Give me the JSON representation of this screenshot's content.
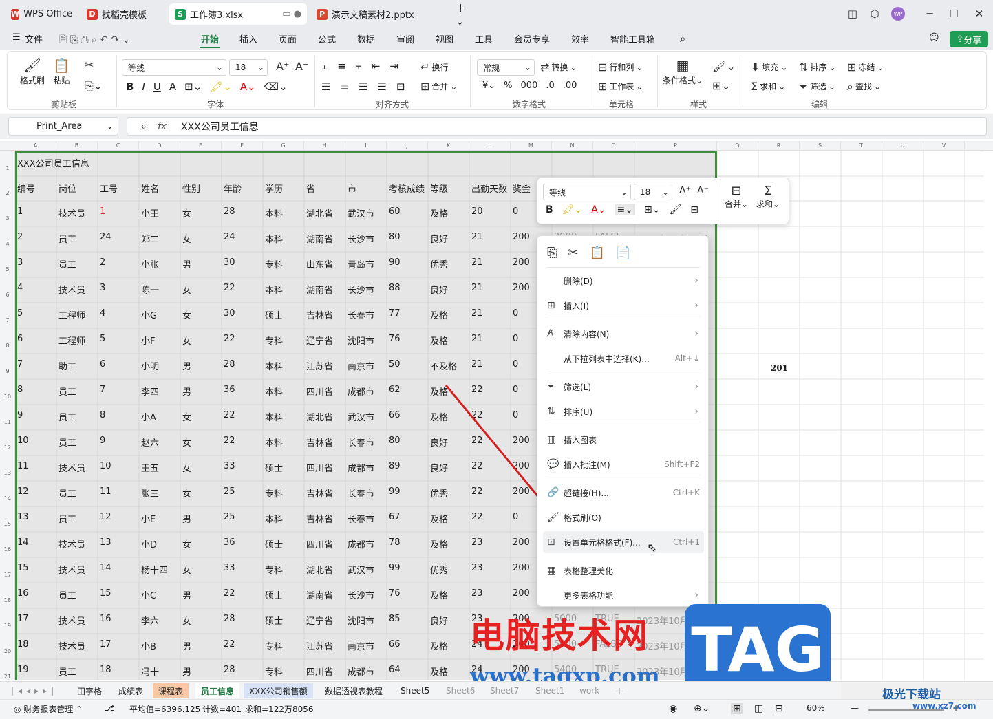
{
  "tabs": [
    {
      "label": "WPS Office",
      "icon": "wps-logo-icon",
      "color": "#d9372b",
      "glyph": "W"
    },
    {
      "label": "找稻壳模板",
      "icon": "docer-icon",
      "color": "#d9372b",
      "glyph": "D"
    },
    {
      "label": "工作簿3.xlsx",
      "icon": "spreadsheet-icon",
      "color": "#1e9b54",
      "glyph": "S"
    },
    {
      "label": "演示文稿素材2.pptx",
      "icon": "presentation-icon",
      "color": "#d84a2b",
      "glyph": "P"
    }
  ],
  "menu": [
    "文件",
    "开始",
    "插入",
    "页面",
    "公式",
    "数据",
    "审阅",
    "视图",
    "工具",
    "会员专享",
    "效率",
    "智能工具箱"
  ],
  "share": "分享",
  "ribbon": {
    "format_painter": "格式刷",
    "paste": "粘贴",
    "clipboard": "剪贴板",
    "font_name": "等线",
    "font_size": "18",
    "font": "字体",
    "wrap": "换行",
    "merge": "合并",
    "align": "对齐方式",
    "numfmt": "常规",
    "convert": "转换",
    "number": "数字格式",
    "rowcol": "行和列",
    "sheet": "工作表",
    "cells": "单元格",
    "condfmt": "条件格式",
    "styles": "样式",
    "fill": "填充",
    "sort": "排序",
    "freeze": "冻结",
    "sum": "求和",
    "filter": "筛选",
    "find": "查找",
    "edit": "编辑"
  },
  "namebox": "Print_Area",
  "formula": "XXX公司员工信息",
  "columns": [
    "A",
    "B",
    "C",
    "D",
    "E",
    "F",
    "G",
    "H",
    "I",
    "J",
    "K",
    "L",
    "M",
    "N",
    "O",
    "P",
    "Q",
    "R",
    "S",
    "T",
    "U",
    "V"
  ],
  "rows": [
    "1",
    "2",
    "3",
    "4",
    "5",
    "6",
    "7",
    "8",
    "9",
    "10",
    "11",
    "12",
    "13",
    "14",
    "15",
    "16",
    "17",
    "18",
    "19",
    "20",
    "21"
  ],
  "title": "XXX公司员工信息",
  "headers": [
    "编号",
    "岗位",
    "工号",
    "姓名",
    "性别",
    "年龄",
    "学历",
    "省",
    "市",
    "考核成绩",
    "等级",
    "出勤天数",
    "奖金"
  ],
  "data": [
    [
      "1",
      "技术员",
      "1",
      "小王",
      "女",
      "28",
      "本科",
      "湖北省",
      "武汉市",
      "60",
      "及格",
      "20",
      "0"
    ],
    [
      "2",
      "员工",
      "24",
      "郑二",
      "女",
      "24",
      "本科",
      "湖南省",
      "长沙市",
      "80",
      "良好",
      "21",
      "200"
    ],
    [
      "3",
      "员工",
      "2",
      "小张",
      "男",
      "30",
      "专科",
      "山东省",
      "青岛市",
      "90",
      "优秀",
      "21",
      "200"
    ],
    [
      "4",
      "技术员",
      "3",
      "陈一",
      "女",
      "22",
      "本科",
      "湖南省",
      "长沙市",
      "88",
      "良好",
      "21",
      "200"
    ],
    [
      "5",
      "工程师",
      "4",
      "小G",
      "女",
      "30",
      "硕士",
      "吉林省",
      "长春市",
      "77",
      "及格",
      "21",
      "0"
    ],
    [
      "6",
      "工程师",
      "5",
      "小F",
      "女",
      "22",
      "专科",
      "辽宁省",
      "沈阳市",
      "76",
      "及格",
      "21",
      "0"
    ],
    [
      "7",
      "助工",
      "6",
      "小明",
      "男",
      "28",
      "本科",
      "江苏省",
      "南京市",
      "50",
      "不及格",
      "21",
      "0"
    ],
    [
      "8",
      "员工",
      "7",
      "李四",
      "男",
      "36",
      "本科",
      "四川省",
      "成都市",
      "62",
      "及格",
      "22",
      "0"
    ],
    [
      "9",
      "员工",
      "8",
      "小A",
      "女",
      "22",
      "本科",
      "湖北省",
      "武汉市",
      "66",
      "及格",
      "22",
      "0"
    ],
    [
      "10",
      "员工",
      "9",
      "赵六",
      "女",
      "22",
      "本科",
      "吉林省",
      "长春市",
      "80",
      "良好",
      "22",
      "200"
    ],
    [
      "11",
      "技术员",
      "10",
      "王五",
      "女",
      "33",
      "硕士",
      "四川省",
      "成都市",
      "89",
      "良好",
      "22",
      "200"
    ],
    [
      "12",
      "员工",
      "11",
      "张三",
      "女",
      "25",
      "专科",
      "吉林省",
      "长春市",
      "99",
      "优秀",
      "22",
      "200"
    ],
    [
      "13",
      "员工",
      "12",
      "小E",
      "男",
      "25",
      "本科",
      "吉林省",
      "长春市",
      "67",
      "及格",
      "22",
      "0"
    ],
    [
      "14",
      "技术员",
      "13",
      "小D",
      "女",
      "36",
      "硕士",
      "四川省",
      "成都市",
      "78",
      "及格",
      "23",
      "200"
    ],
    [
      "15",
      "技术员",
      "14",
      "杨十四",
      "女",
      "33",
      "专科",
      "湖北省",
      "武汉市",
      "99",
      "优秀",
      "23",
      "200"
    ],
    [
      "16",
      "员工",
      "15",
      "小C",
      "男",
      "22",
      "硕士",
      "湖南省",
      "长沙市",
      "76",
      "及格",
      "23",
      "200"
    ],
    [
      "17",
      "技术员",
      "16",
      "李六",
      "女",
      "28",
      "硕士",
      "辽宁省",
      "沈阳市",
      "85",
      "良好",
      "23",
      "200"
    ],
    [
      "18",
      "技术员",
      "17",
      "小B",
      "男",
      "22",
      "专科",
      "江苏省",
      "南京市",
      "66",
      "及格",
      "24",
      "200"
    ],
    [
      "19",
      "员工",
      "18",
      "冯十",
      "男",
      "28",
      "专科",
      "四川省",
      "成都市",
      "64",
      "及格",
      "24",
      "200"
    ]
  ],
  "extra": [
    {
      "r": 3,
      "cells": [
        "3900",
        "FALSE",
        "2023年10月13日"
      ]
    },
    {
      "r": 18,
      "cells": [
        "5000",
        "TRUE",
        "2023年10月28日"
      ]
    },
    {
      "r": 19,
      "cells": [
        "5600",
        "FALSE",
        "2023年10月29日"
      ]
    },
    {
      "r": 20,
      "cells": [
        "5400",
        "TRUE",
        "2023年10月30日"
      ]
    }
  ],
  "r9_value": "201",
  "mini": {
    "font": "等线",
    "size": "18",
    "merge": "合并",
    "sum": "求和"
  },
  "context_menu": [
    {
      "label": "删除(D)",
      "icon": "delete-icon",
      "arrow": true
    },
    {
      "label": "插入(I)",
      "icon": "insert-icon",
      "arrow": true
    },
    {
      "label": "清除内容(N)",
      "icon": "clear-icon",
      "arrow": true
    },
    {
      "label": "从下拉列表中选择(K)...",
      "shortcut": "Alt+↓"
    },
    {
      "label": "筛选(L)",
      "icon": "filter-icon",
      "arrow": true
    },
    {
      "label": "排序(U)",
      "icon": "sort-icon",
      "arrow": true
    },
    {
      "label": "插入图表",
      "icon": "chart-icon"
    },
    {
      "label": "插入批注(M)",
      "icon": "comment-icon",
      "shortcut": "Shift+F2"
    },
    {
      "label": "超链接(H)...",
      "icon": "link-icon",
      "shortcut": "Ctrl+K"
    },
    {
      "label": "格式刷(O)",
      "icon": "format-painter-icon"
    },
    {
      "label": "设置单元格格式(F)...",
      "icon": "format-cells-icon",
      "shortcut": "Ctrl+1"
    },
    {
      "label": "表格整理美化",
      "icon": "beautify-icon"
    },
    {
      "label": "更多表格功能",
      "arrow": true
    }
  ],
  "sheets": [
    "田字格",
    "成绩表",
    "课程表",
    "员工信息",
    "XXX公司销售额",
    "数据透视表教程",
    "Sheet5",
    "Sheet6",
    "Sheet7",
    "Sheet1",
    "work"
  ],
  "status": {
    "manager": "财务报表管理",
    "avg": "平均值=6396.125",
    "count": "计数=401",
    "sum": "求和=122万8056",
    "zoom": "60%"
  },
  "watermark": {
    "site": "电脑技术网",
    "url": "www.tagxp.com",
    "tag": "TAG",
    "brand": "极光下载站",
    "brand_url": "www.xz7.com"
  }
}
